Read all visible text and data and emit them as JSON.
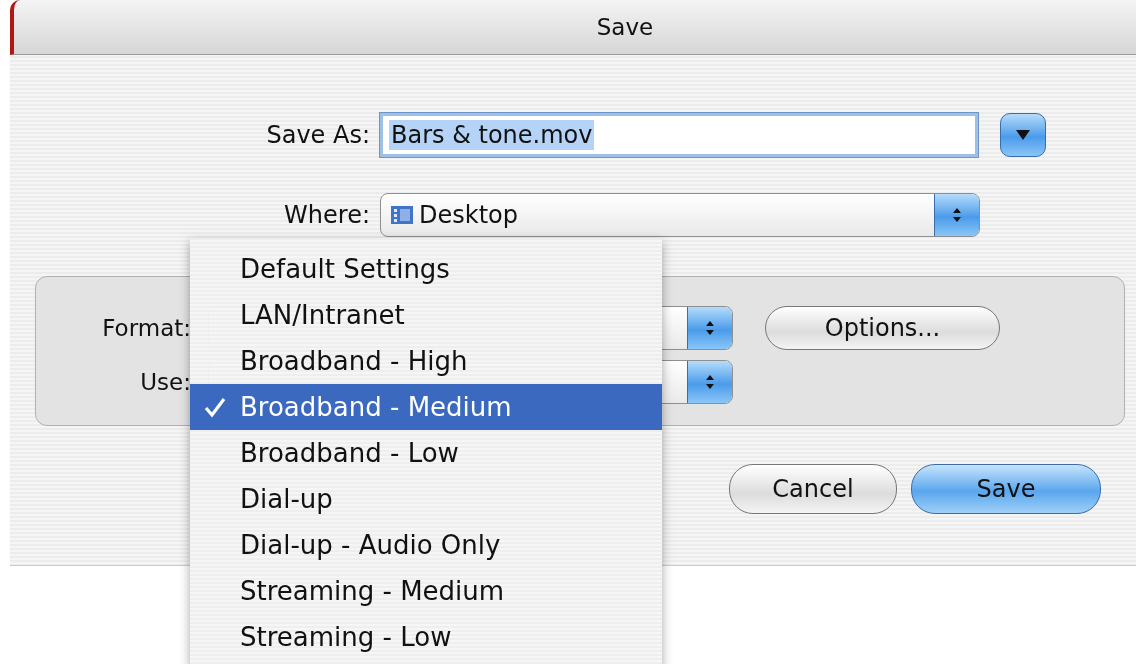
{
  "window": {
    "title": "Save"
  },
  "save_as": {
    "label": "Save As:",
    "value": "Bars & tone.mov",
    "text_selected": true
  },
  "where": {
    "label": "Where:",
    "value": "Desktop"
  },
  "format": {
    "label": "Format:"
  },
  "options_button": "Options...",
  "use": {
    "label": "Use:"
  },
  "use_menu": {
    "items": [
      {
        "label": "Default Settings",
        "selected": false
      },
      {
        "label": "LAN/Intranet",
        "selected": false
      },
      {
        "label": "Broadband - High",
        "selected": false
      },
      {
        "label": "Broadband - Medium",
        "selected": true
      },
      {
        "label": "Broadband - Low",
        "selected": false
      },
      {
        "label": "Dial-up",
        "selected": false
      },
      {
        "label": "Dial-up - Audio Only",
        "selected": false
      },
      {
        "label": "Streaming - Medium",
        "selected": false
      },
      {
        "label": "Streaming - Low",
        "selected": false
      }
    ]
  },
  "buttons": [
    {
      "label": "Cancel",
      "default": false
    },
    {
      "label": "Save",
      "default": true
    }
  ]
}
